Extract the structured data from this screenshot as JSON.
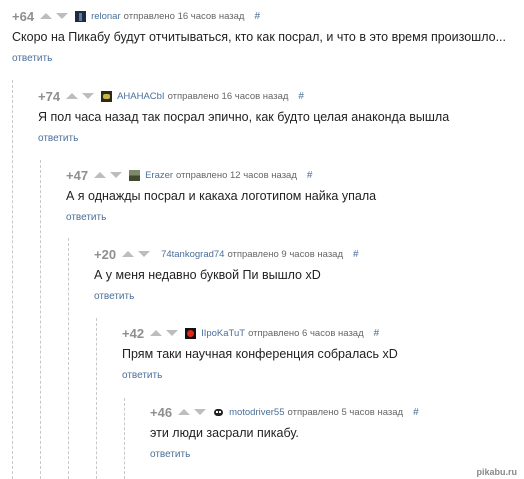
{
  "comments": [
    {
      "rating": "+64",
      "author": "relonar",
      "time": "отправлено 16 часов назад",
      "hash": "#",
      "text": "Скоро на Пикабу будут отчитываться, кто как посрал, и что в это время произошло...",
      "reply": "ответить",
      "avatar": "dark-figure-avatar"
    },
    {
      "rating": "+74",
      "author": "AHAHACbI",
      "time": "отправлено 16 часов назад",
      "hash": "#",
      "text": "Я пол часа назад так посрал эпично, как будто целая анаконда вышла",
      "reply": "ответить",
      "avatar": "monster-avatar"
    },
    {
      "rating": "+47",
      "author": "Erazer",
      "time": "отправлено 12 часов назад",
      "hash": "#",
      "text": "А я однажды посрал и какаха логотипом найка упала",
      "reply": "ответить",
      "avatar": "landscape-avatar"
    },
    {
      "rating": "+20",
      "author": "74tankograd74",
      "time": "отправлено 9 часов назад",
      "hash": "#",
      "text": "А у меня недавно буквой Пи вышло xD",
      "reply": "ответить",
      "avatar": ""
    },
    {
      "rating": "+42",
      "author": "IIpoKaTuT",
      "time": "отправлено 6 часов назад",
      "hash": "#",
      "text": "Прям таки научная конференция собралась xD",
      "reply": "ответить",
      "avatar": "red-dot-avatar"
    },
    {
      "rating": "+46",
      "author": "motodriver55",
      "time": "отправлено 5 часов назад",
      "hash": "#",
      "text": "эти люди засрали пикабу.",
      "reply": "ответить",
      "avatar": "skull-avatar"
    }
  ],
  "watermark": "pikabu.ru"
}
